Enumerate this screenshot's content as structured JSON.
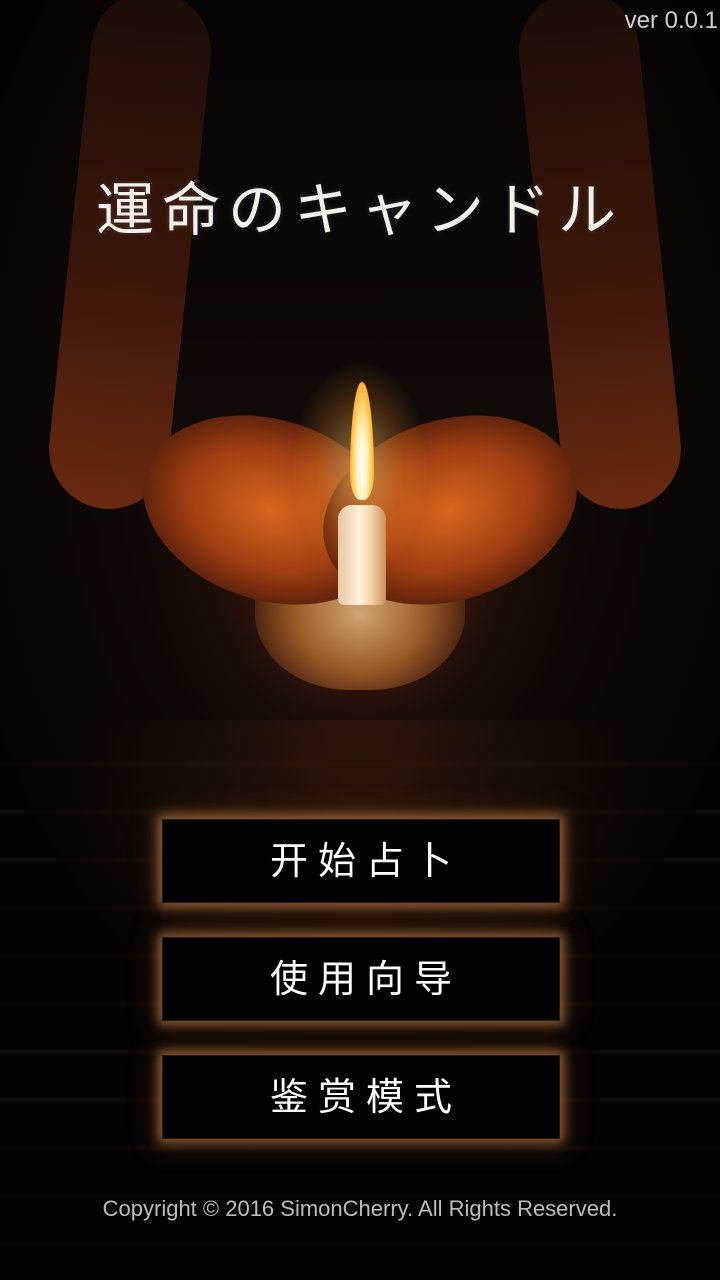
{
  "app": {
    "version": "ver 0.0.1",
    "title": "運命のキャンドル"
  },
  "background": {
    "description_icon": "candle-in-hands-image"
  },
  "menu": {
    "start_label": "开始占卜",
    "guide_label": "使用向导",
    "gallery_label": "鉴赏模式"
  },
  "footer": {
    "copyright": "Copyright © 2016 SimonCherry. All Rights Reserved."
  },
  "colors": {
    "button_bg": "#000000",
    "button_glow": "#dc965a",
    "title_text": "#f4f1ea"
  }
}
